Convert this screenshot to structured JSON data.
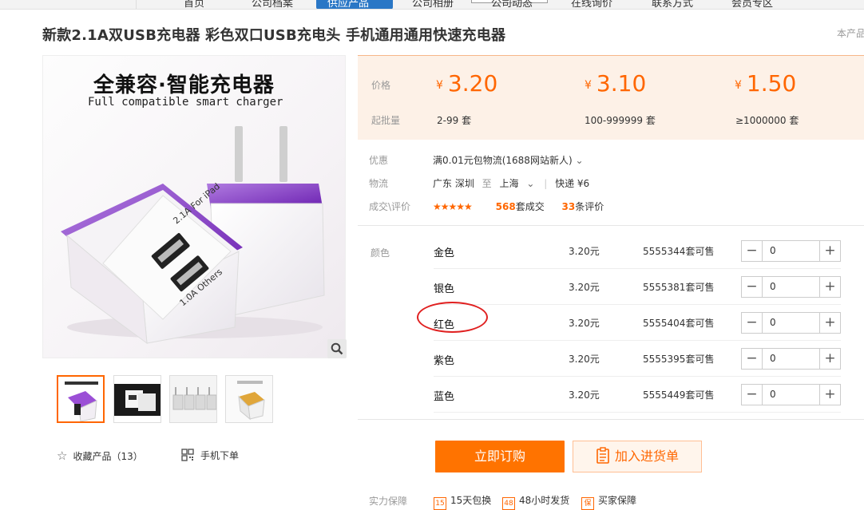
{
  "topnav": {
    "items": [
      "首页",
      "公司档案",
      "供应产品",
      "公司相册",
      "公司动态",
      "在线询价",
      "联系方式",
      "会员专区"
    ]
  },
  "product": {
    "title": "新款2.1A双USB充电器 彩色双口USB充电头 手机通用通用快速充电器",
    "right_note": "本产品",
    "image_headline": "全兼容·智能充电器",
    "image_subline": "Full compatible smart charger",
    "image_device_text": [
      "2.1A For iPad",
      "1.0A Others"
    ]
  },
  "actions": {
    "favorite": "收藏产品（13）",
    "mobile_order": "手机下单"
  },
  "price_box": {
    "price_label": "价格",
    "min_label": "起批量",
    "currency": "¥",
    "tiers": [
      {
        "price": "3.20",
        "range": "2-99",
        "unit": "套"
      },
      {
        "price": "3.10",
        "range": "100-999999",
        "unit": "套"
      },
      {
        "price": "1.50",
        "range": "≥1000000",
        "unit": "套"
      }
    ]
  },
  "info": {
    "promo_label": "优惠",
    "promo_value": "满0.01元包物流(1688网站新人)",
    "logistics_label": "物流",
    "origin": "广东 深圳",
    "to_word": "至",
    "destination": "上海",
    "shipping": "快递 ¥6",
    "deal_label": "成交\\评价",
    "rating_stars": "★★★★★",
    "deals_count": "568",
    "deals_unit": "套成交",
    "reviews_count": "33",
    "reviews_unit": "条评价"
  },
  "sku": {
    "label": "颜色",
    "rows": [
      {
        "name": "金色",
        "price": "3.20元",
        "stock": "5555344套可售",
        "qty": "0"
      },
      {
        "name": "银色",
        "price": "3.20元",
        "stock": "5555381套可售",
        "qty": "0"
      },
      {
        "name": "红色",
        "price": "3.20元",
        "stock": "5555404套可售",
        "qty": "0"
      },
      {
        "name": "紫色",
        "price": "3.20元",
        "stock": "5555395套可售",
        "qty": "0"
      },
      {
        "name": "蓝色",
        "price": "3.20元",
        "stock": "5555449套可售",
        "qty": "0"
      }
    ],
    "minus": "−",
    "plus": "+"
  },
  "buttons": {
    "buy_now": "立即订购",
    "add_to_list": "加入进货单"
  },
  "guarantee": {
    "label": "实力保障",
    "items": [
      {
        "icon": "15",
        "text": "15天包换"
      },
      {
        "icon": "48",
        "text": "48小时发货"
      },
      {
        "icon": "保",
        "text": "买家保障"
      }
    ]
  },
  "colors": {
    "accent": "#ff6600",
    "nav_active": "#2a77c6",
    "annotation": "#e02020"
  }
}
